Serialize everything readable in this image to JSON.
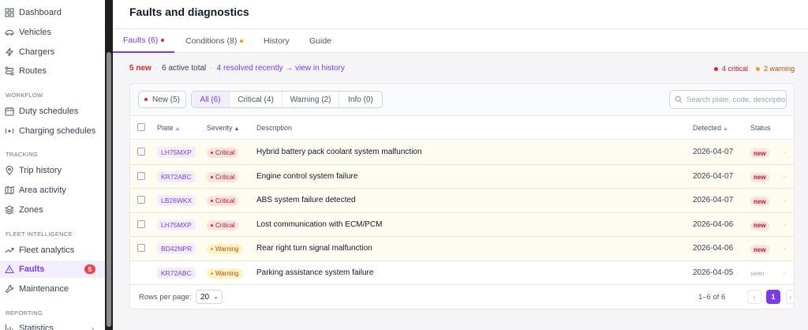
{
  "sidebar": {
    "items_top": [
      {
        "label": "Dashboard",
        "icon": "grid-icon"
      },
      {
        "label": "Vehicles",
        "icon": "car-icon"
      },
      {
        "label": "Chargers",
        "icon": "bolt-icon"
      },
      {
        "label": "Routes",
        "icon": "route-icon"
      }
    ],
    "section_workflow": "WORKFLOW",
    "items_workflow": [
      {
        "label": "Duty schedules",
        "icon": "calendar-icon"
      },
      {
        "label": "Charging schedules",
        "icon": "charging-icon"
      }
    ],
    "section_tracking": "TRACKING",
    "items_tracking": [
      {
        "label": "Trip history",
        "icon": "pin-icon"
      },
      {
        "label": "Area activity",
        "icon": "map-icon"
      },
      {
        "label": "Zones",
        "icon": "layers-icon"
      }
    ],
    "section_fleet": "FLEET INTELLIGENCE",
    "items_fleet": [
      {
        "label": "Fleet analytics",
        "icon": "trend-icon"
      },
      {
        "label": "Faults",
        "icon": "warning-icon",
        "badge": "5"
      },
      {
        "label": "Maintenance",
        "icon": "wrench-icon"
      }
    ],
    "section_reporting": "REPORTING",
    "items_reporting": [
      {
        "label": "Statistics",
        "icon": "chart-icon"
      }
    ]
  },
  "page": {
    "title": "Faults and diagnostics"
  },
  "tabs": [
    {
      "label": "Faults (6)",
      "dot_color": "#dc2626"
    },
    {
      "label": "Conditions (8)",
      "dot_color": "#f59e0b"
    },
    {
      "label": "History"
    },
    {
      "label": "Guide"
    }
  ],
  "summary": {
    "new": "5 new",
    "sep1": "·",
    "active": "6 active total",
    "sep2": "·",
    "resolved_link": "4 resolved recently → view in history",
    "critical": "4 critical",
    "warning": "2 warning"
  },
  "filters": {
    "new_pill": "New (5)",
    "segments": [
      "All (6)",
      "Critical (4)",
      "Warning (2)",
      "Info (0)"
    ],
    "search_placeholder": "Search plate, code, description"
  },
  "table": {
    "headers": {
      "plate": "Plate",
      "severity": "Severity",
      "description": "Description",
      "detected": "Detected",
      "status": "Status"
    },
    "rows": [
      {
        "plate": "LH75MXP",
        "severity": "Critical",
        "description": "Hybrid battery pack coolant system malfunction",
        "detected": "2026-04-07",
        "status": "new"
      },
      {
        "plate": "KR72ABC",
        "severity": "Critical",
        "description": "Engine control system failure",
        "detected": "2026-04-07",
        "status": "new"
      },
      {
        "plate": "LB26WKX",
        "severity": "Critical",
        "description": "ABS system failure detected",
        "detected": "2026-04-07",
        "status": "new"
      },
      {
        "plate": "LH75MXP",
        "severity": "Critical",
        "description": "Lost communication with ECM/PCM",
        "detected": "2026-04-06",
        "status": "new"
      },
      {
        "plate": "BD42NPR",
        "severity": "Warning",
        "description": "Rear right turn signal malfunction",
        "detected": "2026-04-06",
        "status": "new"
      },
      {
        "plate": "KR72ABC",
        "severity": "Warning",
        "description": "Parking assistance system failure",
        "detected": "2026-04-05",
        "status": "seen"
      }
    ]
  },
  "footer": {
    "rows_per_page_label": "Rows per page:",
    "rows_per_page_value": "20",
    "range": "1–6 of 6",
    "prev": "‹",
    "current_page": "1",
    "next": "›"
  },
  "colors": {
    "accent": "#7c3aed",
    "critical": "#dc2626",
    "warning": "#f59e0b"
  }
}
